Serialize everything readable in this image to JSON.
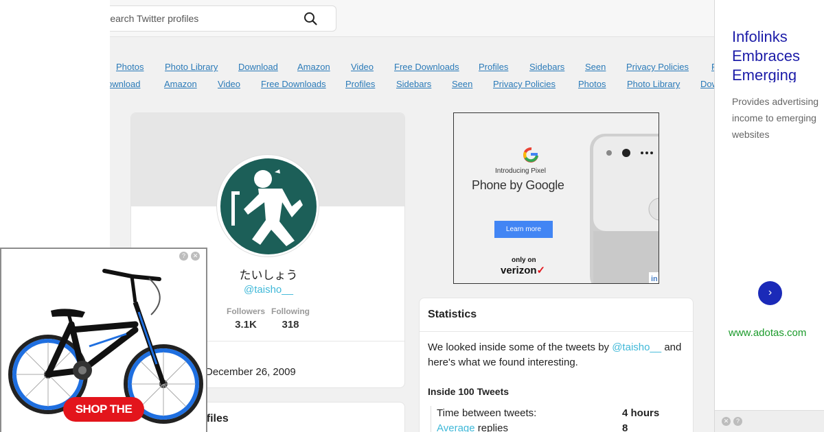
{
  "search": {
    "placeholder": "Search Twitter profiles"
  },
  "nav_row1": [
    "Photos",
    "Photo Library",
    "Download",
    "Amazon",
    "Video",
    "Free Downloads",
    "Profiles",
    "Sidebars",
    "Seen",
    "Privacy Policies",
    "F"
  ],
  "nav_row2": [
    "ownload",
    "Amazon",
    "Video",
    "Free Downloads",
    "Profiles",
    "Sidebars",
    "Seen",
    "Privacy Policies",
    "Photos",
    "Photo Library",
    "Dow"
  ],
  "profile": {
    "display_name": "たいしょう",
    "handle": "@taisho__",
    "followers_label": "Followers",
    "followers_value": "3.1K",
    "following_label": "Following",
    "following_value": "318",
    "joined": "December 26, 2009"
  },
  "profiles_section": {
    "title": "ofiles"
  },
  "google_ad": {
    "intro": "Introducing Pixel",
    "headline": "Phone by Google",
    "cta": "Learn more",
    "only_on": "only on",
    "carrier": "verizon"
  },
  "statistics": {
    "title": "Statistics",
    "intro_before": "We looked inside some of the tweets by ",
    "intro_handle": "@taisho__",
    "intro_after": " and here's what we found interesting.",
    "inside_title": "Inside 100 Tweets",
    "rows": [
      {
        "label": "Time between tweets:",
        "value": "4 hours"
      },
      {
        "label_link": "Average",
        "label_rest": " replies",
        "value": "8"
      }
    ]
  },
  "right_ad": {
    "title": "Infolinks Embraces Emerging",
    "description": "Provides advertising income to emerging websites",
    "url": "www.adotas.com",
    "next_icon": "chevron-right-icon"
  },
  "bike_ad": {
    "cta": "SHOP THE SALE"
  },
  "colors": {
    "link": "#2a7ab8",
    "handle": "#3fb8d8",
    "avatar_bg": "#1c5f58",
    "ad_title": "#1c1ca8",
    "ad_url": "#1a9a2a",
    "ad_button": "#1b2ab8",
    "sale_red": "#e3151c"
  }
}
